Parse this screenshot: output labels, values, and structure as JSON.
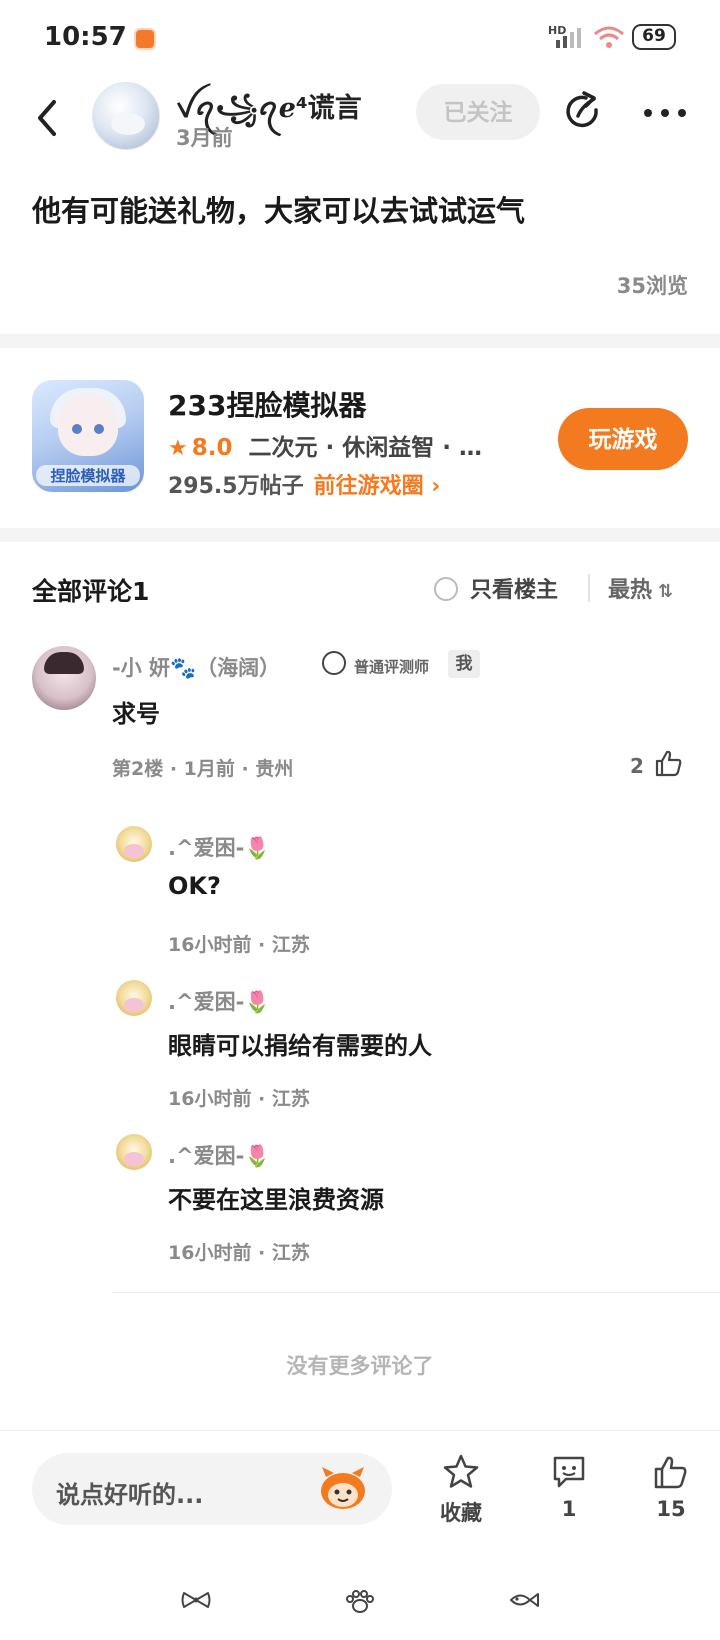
{
  "status_bar": {
    "time": "10:57",
    "network": "HD",
    "battery": "69"
  },
  "header": {
    "author_name": "ꪜꪖ꧁ꪖℯ⁴谎言",
    "post_time": "3月前",
    "follow_label": "已关注"
  },
  "post": {
    "title": "他有可能送礼物，大家可以去试试运气",
    "views": "35浏览"
  },
  "game": {
    "icon_text": "捏脸模拟器",
    "name": "233捏脸模拟器",
    "rating": "8.0",
    "tags": "二次元 · 休闲益智 · …",
    "posts": "295.5万帖子",
    "circle_link": "前往游戏圈 ›",
    "play_label": "玩游戏",
    "accent": "#f47a1f"
  },
  "comments_header": {
    "title": "全部评论1",
    "only_op": "只看楼主",
    "sort": "最热",
    "sort_icon": "⇅"
  },
  "comment": {
    "name": "-小   妍🐾（海阔）",
    "badge": "普通评测师",
    "me_tag": "我",
    "text": "求号",
    "meta": "第2楼 · 1月前 · 贵州",
    "likes": "2"
  },
  "replies": [
    {
      "name": ".^爱困-",
      "text": "OK?",
      "meta": "16小时前 · 江苏"
    },
    {
      "name": ".^爱困-",
      "text": "眼睛可以捐给有需要的人",
      "meta": "16小时前 · 江苏"
    },
    {
      "name": ".^爱困-",
      "text": "不要在这里浪费资源",
      "meta": "16小时前 · 江苏"
    }
  ],
  "no_more": "没有更多评论了",
  "bottom_bar": {
    "placeholder": "说点好听的...",
    "favorite_label": "收藏",
    "comment_count": "1",
    "like_count": "15"
  }
}
